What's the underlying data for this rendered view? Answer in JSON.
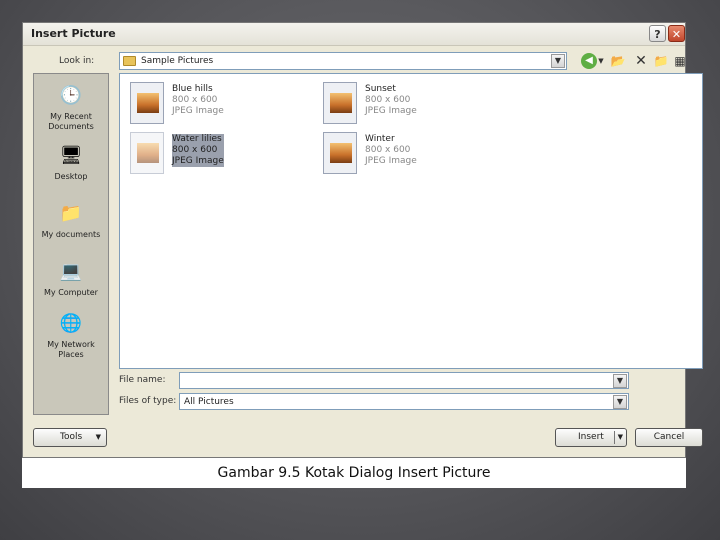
{
  "dialog": {
    "title": "Insert Picture",
    "help_glyph": "?",
    "close_glyph": "✕"
  },
  "look_in": {
    "label": "Look in:",
    "value": "Sample Pictures"
  },
  "toolbar_icons": [
    "back-icon",
    "up-folder-icon",
    "delete-icon",
    "new-folder-icon",
    "views-icon"
  ],
  "places": [
    {
      "label": "My Recent Documents",
      "icon": "recent-documents-icon"
    },
    {
      "label": "Desktop",
      "icon": "desktop-icon"
    },
    {
      "label": "My documents",
      "icon": "my-documents-icon"
    },
    {
      "label": "My Computer",
      "icon": "my-computer-icon"
    },
    {
      "label": "My Network Places",
      "icon": "network-places-icon"
    }
  ],
  "files": [
    {
      "name": "Blue hills",
      "dims": "800 x 600",
      "type": "JPEG Image",
      "selected": false
    },
    {
      "name": "Sunset",
      "dims": "800 x 600",
      "type": "JPEG Image",
      "selected": false
    },
    {
      "name": "Water lilies",
      "dims": "800 x 600",
      "type": "JPEG Image",
      "selected": true
    },
    {
      "name": "Winter",
      "dims": "800 x 600",
      "type": "JPEG Image",
      "selected": false
    }
  ],
  "file_name": {
    "label": "File name:",
    "value": ""
  },
  "file_type": {
    "label": "Files of type:",
    "value": "All Pictures"
  },
  "buttons": {
    "tools": "Tools",
    "insert": "Insert",
    "cancel": "Cancel"
  },
  "caption": "Gambar 9.5 Kotak Dialog Insert Picture"
}
